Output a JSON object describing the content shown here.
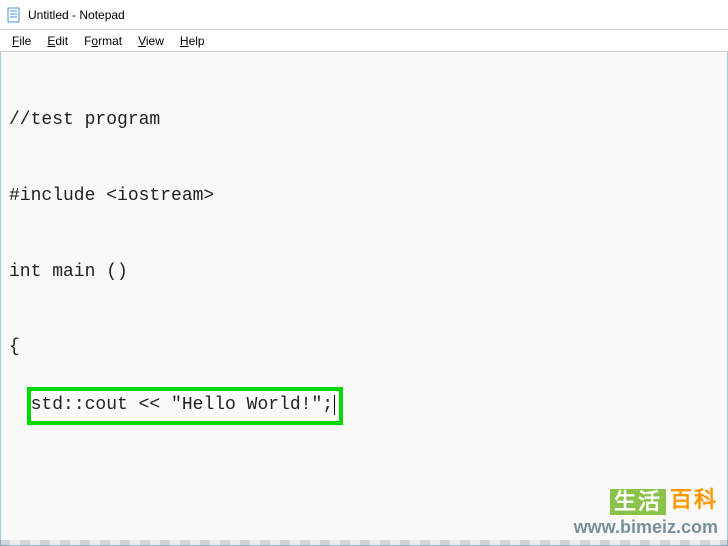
{
  "titlebar": {
    "icon_name": "notepad-icon",
    "title": "Untitled - Notepad"
  },
  "menubar": {
    "items": [
      {
        "label": "File",
        "hotkey": "F"
      },
      {
        "label": "Edit",
        "hotkey": "E"
      },
      {
        "label": "Format",
        "hotkey": "o"
      },
      {
        "label": "View",
        "hotkey": "V"
      },
      {
        "label": "Help",
        "hotkey": "H"
      }
    ]
  },
  "editor": {
    "lines": [
      "//test program",
      "#include <iostream>",
      "int main ()",
      "{"
    ],
    "highlighted_line": "std::cout << \"Hello World!\";"
  },
  "watermark": {
    "cn_left": "生活",
    "cn_right": "百科",
    "url": "www.bimeiz.com"
  }
}
